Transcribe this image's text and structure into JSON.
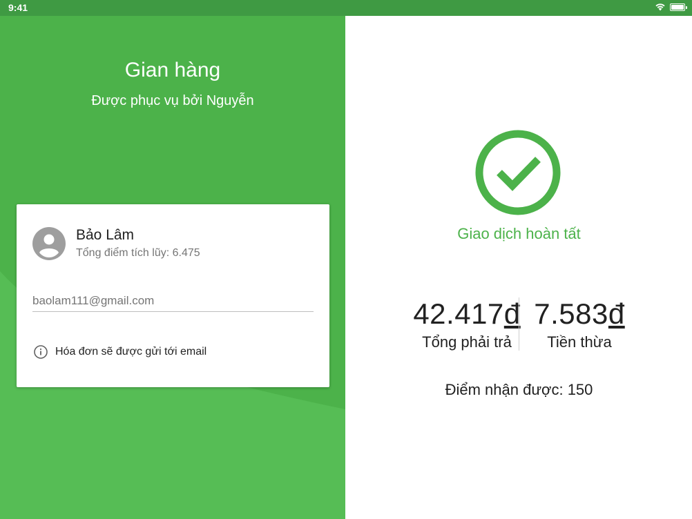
{
  "status_bar": {
    "time": "9:41"
  },
  "store": {
    "title": "Gian hàng",
    "served_by": "Được phục vụ bởi Nguyễn"
  },
  "customer": {
    "name": "Bảo Lâm",
    "points_total": "Tổng điểm tích lũy: 6.475",
    "email_value": "baolam111@gmail.com",
    "email_placeholder": "baolam111@gmail.com",
    "info_note": "Hóa đơn sẽ được gửi tới email"
  },
  "transaction": {
    "status_label": "Giao dịch hoàn tất",
    "total_amount": "42.417",
    "total_currency": "đ",
    "total_label": "Tổng phải trả",
    "change_amount": "7.583",
    "change_currency": "đ",
    "change_label": "Tiền thừa",
    "points_earned": "Điểm nhận được: 150"
  },
  "icons": {
    "wifi": "wifi-icon",
    "battery": "battery-icon",
    "avatar": "account-circle-icon",
    "info": "info-outline-icon",
    "success": "check-circle-icon"
  },
  "colors": {
    "primary_green": "#4cb24a",
    "status_bar": "#3f9a43",
    "text_dark": "#212121",
    "text_secondary": "#757575"
  }
}
